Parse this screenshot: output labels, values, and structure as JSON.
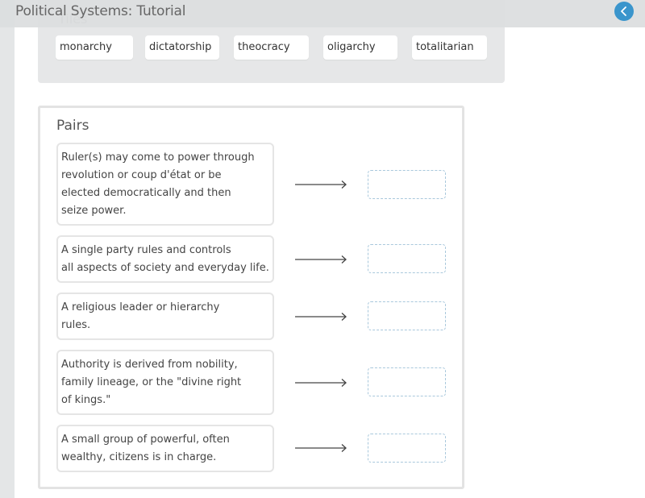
{
  "header": {
    "title": "Political Systems: Tutorial",
    "back_icon": "chevron-left-icon",
    "accent_color": "#3a95cc"
  },
  "tiles": {
    "label": "Tiles",
    "items": [
      {
        "label": "monarchy"
      },
      {
        "label": "dictatorship"
      },
      {
        "label": "theocracy"
      },
      {
        "label": "oligarchy"
      },
      {
        "label": "totalitarian"
      }
    ]
  },
  "pairs": {
    "title": "Pairs",
    "items": [
      {
        "text": "Ruler(s) may come to power through\nrevolution or coup d'état or be\nelected democratically and then\nseize power.",
        "target": ""
      },
      {
        "text": "A single party rules and controls\nall aspects of society and everyday life.",
        "target": ""
      },
      {
        "text": "A religious leader or hierarchy\nrules.",
        "target": ""
      },
      {
        "text": "Authority is derived from nobility,\nfamily lineage, or the \"divine right\nof kings.\"",
        "target": ""
      },
      {
        "text": "A small group of powerful, often\nwealthy, citizens is in charge.",
        "target": ""
      }
    ]
  }
}
